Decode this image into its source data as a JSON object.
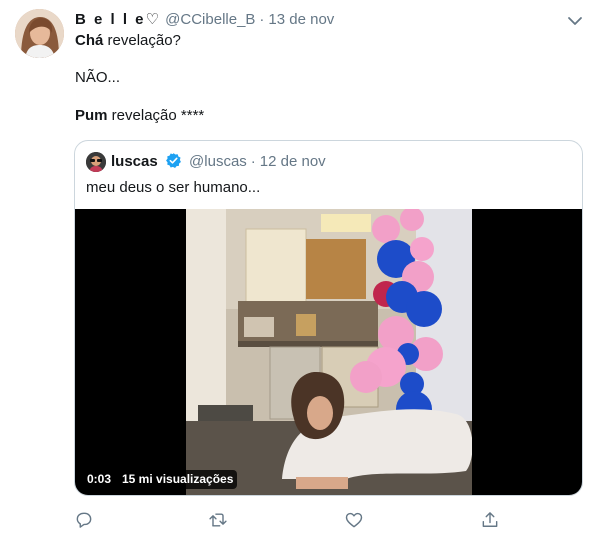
{
  "tweet": {
    "author_name": "B e l l e♡",
    "author_handle": "@CCibelle_B",
    "separator": "·",
    "date": "13 de nov",
    "line1_bold": "Chá",
    "line1_rest": " revelação?",
    "line2": "NÃO...",
    "line3_bold": "Pum",
    "line3_rest": " revelação ****"
  },
  "quoted": {
    "author_name": "luscas",
    "author_handle": "@luscas",
    "separator": "·",
    "date": "12 de nov",
    "text": "meu deus o ser humano...",
    "video": {
      "time": "0:03",
      "views": "15 mi visualizações"
    }
  },
  "actions": {
    "icons": [
      "reply-icon",
      "retweet-icon",
      "like-icon",
      "share-icon"
    ]
  },
  "colors": {
    "text": "#14171a",
    "secondary": "#657786",
    "border": "#ccd6dd",
    "verified": "#1da1f2",
    "icon": "#657786"
  }
}
